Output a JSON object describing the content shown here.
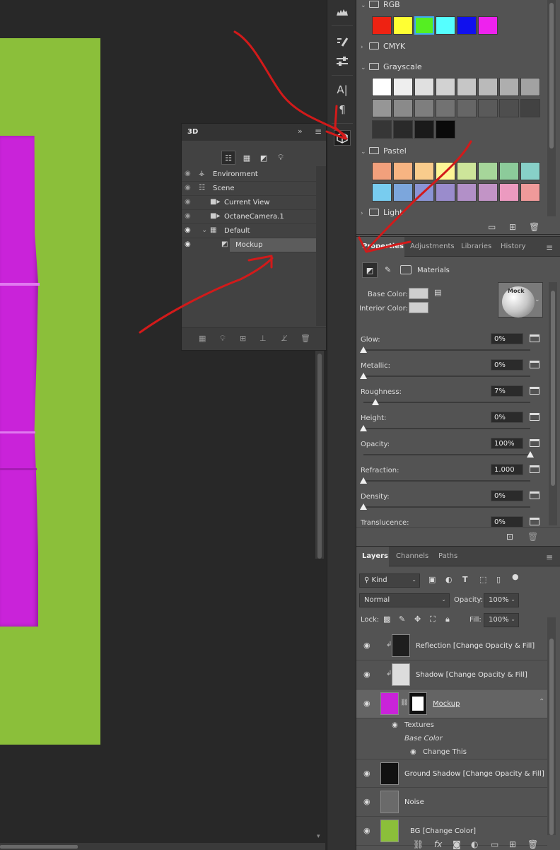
{
  "panel_3d": {
    "title": "3D",
    "items": [
      {
        "label": "Environment"
      },
      {
        "label": "Scene"
      },
      {
        "label": "Current View"
      },
      {
        "label": "OctaneCamera.1"
      },
      {
        "label": "Default"
      },
      {
        "label": "Mockup"
      }
    ]
  },
  "swatches": {
    "groups": [
      {
        "label": "RGB"
      },
      {
        "label": "CMYK"
      },
      {
        "label": "Grayscale"
      },
      {
        "label": "Pastel"
      },
      {
        "label": "Light"
      }
    ],
    "rgb_colors": [
      "#ee2212",
      "#ffff33",
      "#55ee22",
      "#55ffff",
      "#1010ee",
      "#ee22ee"
    ],
    "grayscale_row1": [
      "#ffffff",
      "#eeeeee",
      "#e0e0e0",
      "#d2d2d2",
      "#c6c6c6",
      "#bababa",
      "#aeaeae",
      "#a2a2a2"
    ],
    "grayscale_row2": [
      "#969696",
      "#8a8a8a",
      "#7e7e7e",
      "#727272",
      "#666666",
      "#5a5a5a",
      "#4e4e4e",
      "#424242"
    ],
    "grayscale_row3": [
      "#363636",
      "#2a2a2a",
      "#1a1a1a",
      "#0a0a0a"
    ],
    "pastel_row1": [
      "#f2a07c",
      "#f7b482",
      "#f9cc8c",
      "#fdf596",
      "#cde59a",
      "#a6d69a",
      "#8ccb9a",
      "#87d0c8"
    ],
    "pastel_row2": [
      "#78ccef",
      "#7ca6dc",
      "#8a94d4",
      "#9a8ccc",
      "#b290c8",
      "#c294c6",
      "#ec9ac0",
      "#ef9a9a"
    ]
  },
  "properties": {
    "tabs": [
      {
        "label": "Properties"
      },
      {
        "label": "Adjustments"
      },
      {
        "label": "Libraries"
      },
      {
        "label": "History"
      }
    ],
    "section": "Materials",
    "base_color_label": "Base Color:",
    "interior_color_label": "Interior Color:",
    "material_preview_text": "Mock",
    "fields": [
      {
        "label": "Glow:",
        "value": "0%",
        "level": 0
      },
      {
        "label": "Metallic:",
        "value": "0%",
        "level": 0
      },
      {
        "label": "Roughness:",
        "value": "7%",
        "level": 7
      },
      {
        "label": "Height:",
        "value": "0%",
        "level": 0
      },
      {
        "label": "Opacity:",
        "value": "100%",
        "level": 100
      },
      {
        "label": "Refraction:",
        "value": "1.000",
        "level": 0
      },
      {
        "label": "Density:",
        "value": "0%",
        "level": 0
      },
      {
        "label": "Translucence:",
        "value": "0%",
        "level": 0
      }
    ]
  },
  "layers": {
    "tabs": [
      {
        "label": "Layers"
      },
      {
        "label": "Channels"
      },
      {
        "label": "Paths"
      }
    ],
    "filter_kind": "Kind",
    "blend_mode": "Normal",
    "opacity_label": "Opacity:",
    "opacity_value": "100%",
    "lock_label": "Lock:",
    "fill_label": "Fill:",
    "fill_value": "100%",
    "rows": [
      {
        "name": "Reflection [Change Opacity & Fill]"
      },
      {
        "name": "Shadow [Change Opacity & Fill]"
      },
      {
        "name": "Mockup"
      },
      {
        "name": "Ground Shadow [Change Opacity & Fill]"
      },
      {
        "name": "Noise"
      },
      {
        "name": "BG [Change Color]"
      }
    ],
    "sub_rows": [
      {
        "label": "Textures"
      },
      {
        "label": "Base Color"
      },
      {
        "label": "Change This"
      }
    ],
    "footer_fx": "fx"
  },
  "colors": {
    "artboard": "#8bbf3a",
    "mockup_magenta": "#c923d9",
    "annotation_red": "#d21a1a",
    "bg_thumb": "#8bbf3a"
  }
}
